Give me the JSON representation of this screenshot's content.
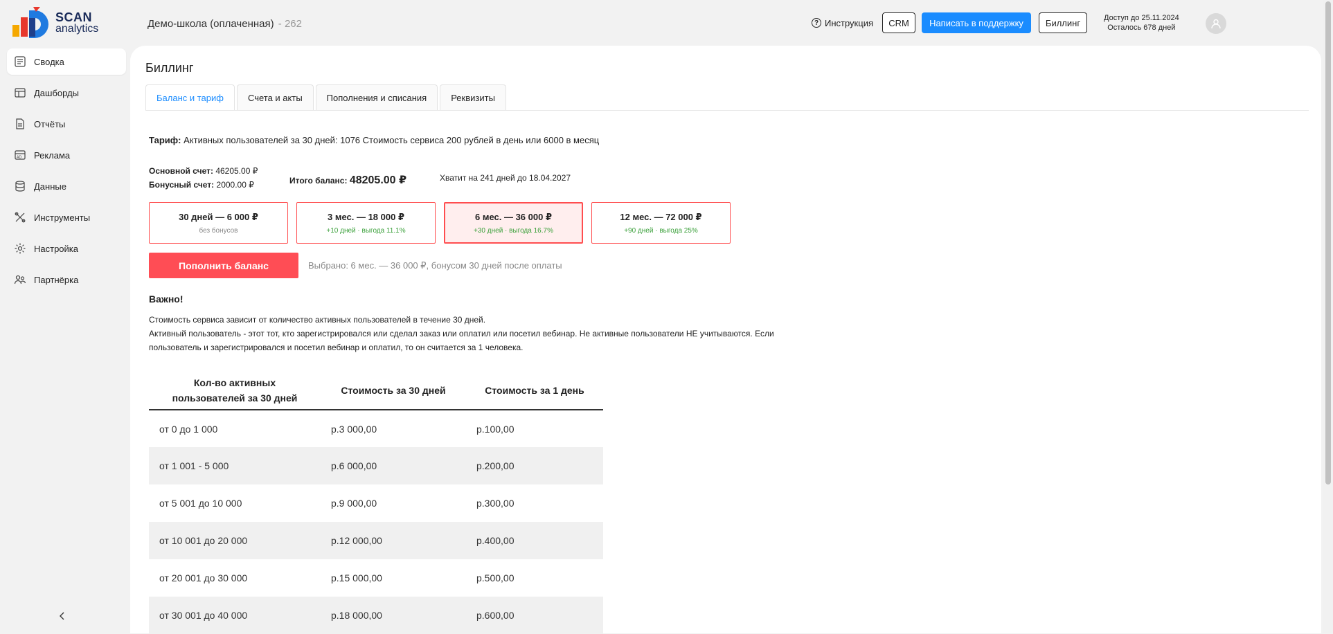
{
  "logo": {
    "line1": "SCAN",
    "line2": "analytics"
  },
  "sidebar": {
    "items": [
      {
        "label": "Сводка",
        "icon": "summary-icon"
      },
      {
        "label": "Дашборды",
        "icon": "dashboard-icon"
      },
      {
        "label": "Отчёты",
        "icon": "reports-icon"
      },
      {
        "label": "Реклама",
        "icon": "ads-icon"
      },
      {
        "label": "Данные",
        "icon": "database-icon"
      },
      {
        "label": "Инструменты",
        "icon": "tools-icon"
      },
      {
        "label": "Настройка",
        "icon": "gear-icon"
      },
      {
        "label": "Партнёрка",
        "icon": "partners-icon"
      }
    ],
    "collapse_icon": "chevron-left-icon"
  },
  "header": {
    "school": "Демо-школа (оплаченная)",
    "school_id": "- 262",
    "instruction": "Инструкция",
    "crm": "CRM",
    "support": "Написать в поддержку",
    "billing": "Биллинг",
    "access_until": "Доступ до 25.11.2024",
    "days_left": "Осталось 678 дней"
  },
  "page": {
    "title": "Биллинг",
    "tabs": [
      "Баланс и тариф",
      "Счета и акты",
      "Пополнения и списания",
      "Реквизиты"
    ]
  },
  "tariff": {
    "label": "Тариф:",
    "text": "Активных пользователей за 30 дней: 1076 Стоимость сервиса 200 рублей в день или 6000 в месяц"
  },
  "balance": {
    "main_label": "Основной счет:",
    "main_value": "46205.00 ₽",
    "bonus_label": "Бонусный счет:",
    "bonus_value": "2000.00 ₽",
    "total_label": "Итого баланс:",
    "total_value": "48205.00 ₽",
    "enough": "Хватит на 241 дней до 18.04.2027"
  },
  "plans": [
    {
      "title": "30 дней — 6 000 ₽",
      "sub": "без бонусов"
    },
    {
      "title": "3 мес. — 18 000 ₽",
      "sub": "+10 дней · выгода 11.1%"
    },
    {
      "title": "6 мес. — 36 000 ₽",
      "sub": "+30 дней · выгода 16.7%"
    },
    {
      "title": "12 мес. — 72 000 ₽",
      "sub": "+90 дней · выгода 25%"
    }
  ],
  "topup": {
    "button": "Пополнить баланс",
    "note": "Выбрано: 6 мес. — 36 000 ₽, бонусом 30 дней после оплаты"
  },
  "important": {
    "title": "Важно!",
    "line1": "Стоимость сервиса зависит от количество активных пользователей в течение 30 дней.",
    "line2": "Активный пользователь - этот тот, кто зарегистрировался или сделал заказ или оплатил или посетил вебинар. Не активные пользователи НЕ учитываются. Если",
    "line3": "пользователь и зарегистрировался и посетил вебинар и оплатил, то он считается за 1 человека."
  },
  "price_table": {
    "headers": [
      "Кол-во активных пользователей за 30 дней",
      "Стоимость за 30 дней",
      "Стоимость за 1 день"
    ],
    "rows": [
      [
        "от 0 до 1 000",
        "р.3 000,00",
        "р.100,00"
      ],
      [
        "от 1 001 - 5 000",
        "р.6 000,00",
        "р.200,00"
      ],
      [
        "от 5 001 до 10 000",
        "р.9 000,00",
        "р.300,00"
      ],
      [
        "от 10 001 до 20 000",
        "р.12 000,00",
        "р.400,00"
      ],
      [
        "от 20 001 до 30 000",
        "р.15 000,00",
        "р.500,00"
      ],
      [
        "от 30 001 до 40 000",
        "р.18 000,00",
        "р.600,00"
      ]
    ]
  },
  "colors": {
    "accent": "#1a8cff",
    "danger": "#ff4d55",
    "green": "#3aa03a"
  }
}
